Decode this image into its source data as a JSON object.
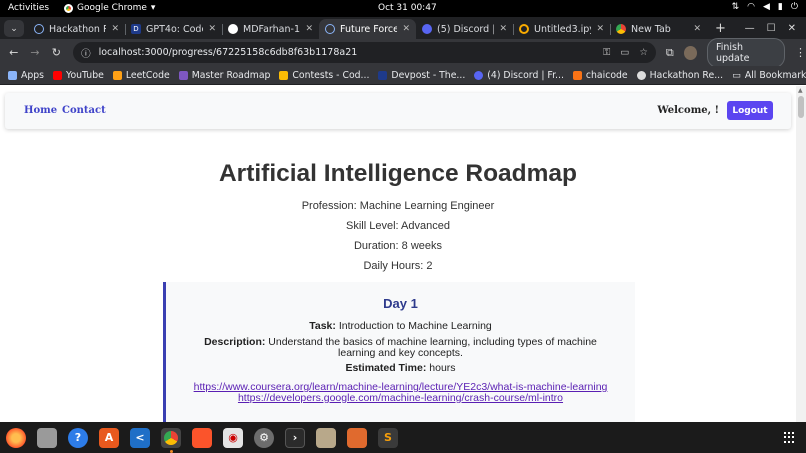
{
  "system_bar": {
    "activities": "Activities",
    "app_name": "Google Chrome",
    "clock": "Oct 31  00:47"
  },
  "tabs": [
    {
      "label": "Hackathon Re",
      "favicon_color": "#8ab4f8",
      "active": false
    },
    {
      "label": "GPT4o: Code",
      "favicon_color": "#1e3a8a",
      "active": false
    },
    {
      "label": "MDFarhan-1/",
      "favicon_color": "#ffffff",
      "active": false
    },
    {
      "label": "Future Force",
      "favicon_color": "#8ab4f8",
      "active": true
    },
    {
      "label": "(5) Discord | 8",
      "favicon_color": "#5865f2",
      "active": false
    },
    {
      "label": "Untitled3.ipyn",
      "favicon_color": "#f9ab00",
      "active": false
    },
    {
      "label": "New Tab",
      "favicon_color": "#9aa0a6",
      "active": false
    }
  ],
  "toolbar": {
    "url": "localhost:3000/progress/67225158c6db8f63b1178a21",
    "update_label": "Finish update"
  },
  "bookmarks": [
    {
      "label": "Apps",
      "color": "#8ab4f8"
    },
    {
      "label": "YouTube",
      "color": "#ff0000"
    },
    {
      "label": "LeetCode",
      "color": "#ffa116"
    },
    {
      "label": "Master Roadmap",
      "color": "#7e57c2"
    },
    {
      "label": "Contests - Cod...",
      "color": "#fbbc05"
    },
    {
      "label": "Devpost - The...",
      "color": "#1e3a8a"
    },
    {
      "label": "(4) Discord | Fr...",
      "color": "#5865f2"
    },
    {
      "label": "chaicode",
      "color": "#f97316"
    },
    {
      "label": "Hackathon Re...",
      "color": "#dddddd"
    }
  ],
  "all_bookmarks": "All Bookmarks",
  "site": {
    "nav": {
      "home": "Home",
      "contact": "Contact",
      "welcome": "Welcome, !",
      "logout": "Logout"
    },
    "title": "Artificial Intelligence Roadmap",
    "profession": "Profession: Machine Learning Engineer",
    "skill_level": "Skill Level: Advanced",
    "duration": "Duration: 8 weeks",
    "daily_hours": "Daily Hours: 2",
    "day": {
      "title": "Day 1",
      "task_label": "Task:",
      "task": "Introduction to Machine Learning",
      "description_label": "Description:",
      "description": "Understand the basics of machine learning, including types of machine learning and key concepts.",
      "estimated_label": "Estimated Time:",
      "estimated": "hours",
      "links": [
        "https://www.coursera.org/learn/machine-learning/lecture/YE2c3/what-is-machine-learning",
        "https://developers.google.com/machine-learning/crash-course/ml-intro"
      ]
    }
  }
}
